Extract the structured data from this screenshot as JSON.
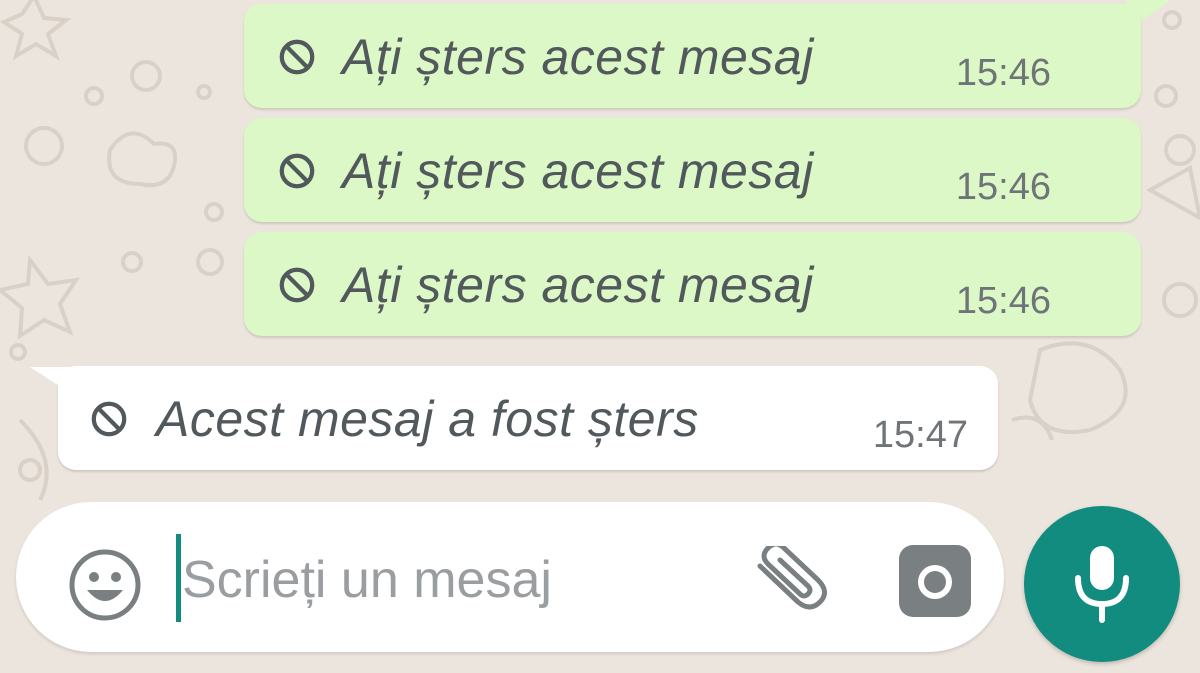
{
  "conversation": {
    "messages": [
      {
        "direction": "outgoing",
        "text": "Ați șters acest mesaj",
        "time": "15:46",
        "icon": "ban-icon"
      },
      {
        "direction": "outgoing",
        "text": "Ați șters acest mesaj",
        "time": "15:46",
        "icon": "ban-icon"
      },
      {
        "direction": "outgoing",
        "text": "Ați șters acest mesaj",
        "time": "15:46",
        "icon": "ban-icon"
      },
      {
        "direction": "incoming",
        "text": "Acest mesaj a fost șters",
        "time": "15:47",
        "icon": "ban-icon"
      }
    ]
  },
  "composer": {
    "placeholder": "Scrieți un mesaj",
    "value": "",
    "emoji_icon": "emoji-icon",
    "attach_icon": "paperclip-icon",
    "camera_icon": "camera-icon"
  },
  "mic_button": {
    "icon": "microphone-icon"
  },
  "colors": {
    "background": "#ece5dd",
    "outgoing_bubble": "#dcf8c6",
    "incoming_bubble": "#ffffff",
    "accent": "#128c7e",
    "icon_gray": "#6f7478"
  }
}
